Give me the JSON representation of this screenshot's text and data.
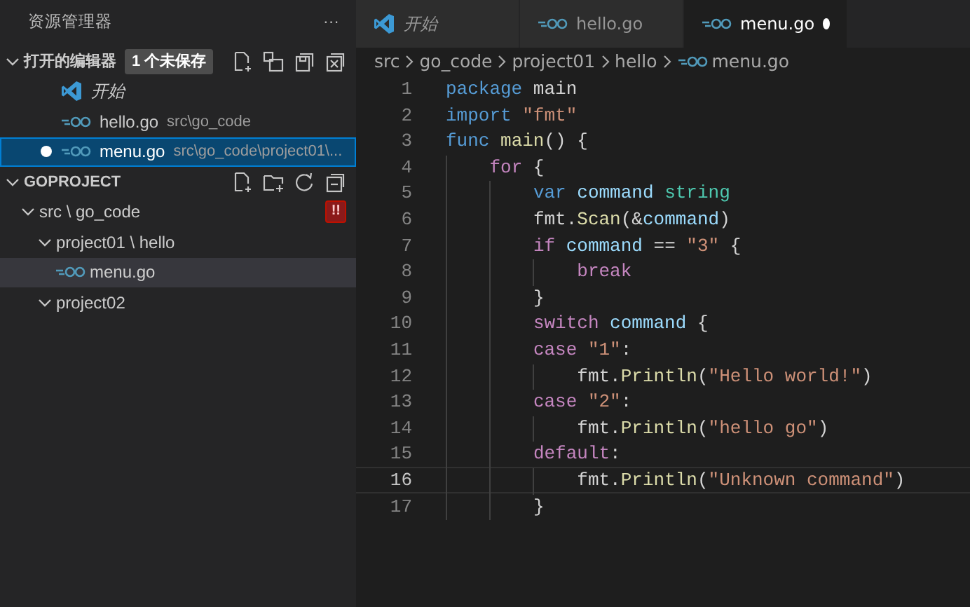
{
  "sidebar": {
    "title": "资源管理器",
    "more": "···",
    "open_editors": {
      "title": "打开的编辑器",
      "expanded": true,
      "badge": "1 个未保存",
      "items": [
        {
          "kind": "welcome",
          "label": "开始",
          "dirty": false,
          "selected": false
        },
        {
          "kind": "go",
          "label": "hello.go",
          "path": "src\\go_code",
          "dirty": false,
          "selected": false
        },
        {
          "kind": "go",
          "label": "menu.go",
          "path": "src\\go_code\\project01\\...",
          "dirty": true,
          "selected": true
        }
      ]
    },
    "project": {
      "title": "GOPROJECT",
      "expanded": true,
      "tree": [
        {
          "kind": "folder",
          "label": "src \\ go_code",
          "expanded": true,
          "badge": "!!",
          "children": [
            {
              "kind": "folder",
              "label": "project01 \\ hello",
              "expanded": true,
              "children": [
                {
                  "kind": "go",
                  "label": "menu.go",
                  "selected": true
                }
              ]
            },
            {
              "kind": "folder",
              "label": "project02",
              "expanded": true
            }
          ]
        }
      ]
    }
  },
  "tabs": [
    {
      "kind": "welcome",
      "label": "开始",
      "selected": false,
      "dirty": false
    },
    {
      "kind": "go",
      "label": "hello.go",
      "selected": false,
      "dirty": false
    },
    {
      "kind": "go",
      "label": "menu.go",
      "selected": true,
      "dirty": true
    }
  ],
  "breadcrumb": [
    {
      "label": "src"
    },
    {
      "label": "go_code"
    },
    {
      "label": "project01"
    },
    {
      "label": "hello"
    },
    {
      "label": "menu.go",
      "kind": "go"
    }
  ],
  "code": [
    {
      "number": "1",
      "current": false,
      "tokens": [
        {
          "kind": "kw",
          "text": "package"
        },
        {
          "kind": "plain",
          "text": " main"
        }
      ]
    },
    {
      "number": "2",
      "current": false,
      "tokens": [
        {
          "kind": "kw",
          "text": "import"
        },
        {
          "kind": "str",
          "text": " \"fmt\""
        }
      ]
    },
    {
      "number": "3",
      "current": false,
      "tokens": [
        {
          "kind": "kw",
          "text": "func"
        },
        {
          "kind": "fn",
          "text": " main"
        },
        {
          "kind": "plain",
          "text": "() {"
        }
      ]
    },
    {
      "number": "4",
      "current": false,
      "tokens": [
        {
          "kind": "ctl",
          "text": "    for"
        },
        {
          "kind": "plain",
          "text": " {"
        }
      ]
    },
    {
      "number": "5",
      "current": false,
      "tokens": [
        {
          "kind": "kw",
          "text": "        var"
        },
        {
          "kind": "var",
          "text": " command"
        },
        {
          "kind": "type",
          "text": " string"
        }
      ]
    },
    {
      "number": "6",
      "current": false,
      "tokens": [
        {
          "kind": "plain",
          "text": "        fmt."
        },
        {
          "kind": "fn",
          "text": "Scan"
        },
        {
          "kind": "plain",
          "text": "(&"
        },
        {
          "kind": "var",
          "text": "command"
        },
        {
          "kind": "plain",
          "text": ")"
        }
      ]
    },
    {
      "number": "7",
      "current": false,
      "tokens": [
        {
          "kind": "ctl",
          "text": "        if"
        },
        {
          "kind": "var",
          "text": " command"
        },
        {
          "kind": "plain",
          "text": " =="
        },
        {
          "kind": "str",
          "text": " \"3\""
        },
        {
          "kind": "plain",
          "text": " {"
        }
      ]
    },
    {
      "number": "8",
      "current": false,
      "tokens": [
        {
          "kind": "ctl",
          "text": "            break"
        }
      ]
    },
    {
      "number": "9",
      "current": false,
      "tokens": [
        {
          "kind": "plain",
          "text": "        }"
        }
      ]
    },
    {
      "number": "10",
      "current": false,
      "tokens": [
        {
          "kind": "ctl",
          "text": "        switch"
        },
        {
          "kind": "var",
          "text": " command"
        },
        {
          "kind": "plain",
          "text": " {"
        }
      ]
    },
    {
      "number": "11",
      "current": false,
      "tokens": [
        {
          "kind": "ctl",
          "text": "        case"
        },
        {
          "kind": "str",
          "text": " \"1\""
        },
        {
          "kind": "plain",
          "text": ":"
        }
      ]
    },
    {
      "number": "12",
      "current": false,
      "tokens": [
        {
          "kind": "plain",
          "text": "            fmt."
        },
        {
          "kind": "fn",
          "text": "Println"
        },
        {
          "kind": "plain",
          "text": "("
        },
        {
          "kind": "str",
          "text": "\"Hello world!\""
        },
        {
          "kind": "plain",
          "text": ")"
        }
      ]
    },
    {
      "number": "13",
      "current": false,
      "tokens": [
        {
          "kind": "ctl",
          "text": "        case"
        },
        {
          "kind": "str",
          "text": " \"2\""
        },
        {
          "kind": "plain",
          "text": ":"
        }
      ]
    },
    {
      "number": "14",
      "current": false,
      "tokens": [
        {
          "kind": "plain",
          "text": "            fmt."
        },
        {
          "kind": "fn",
          "text": "Println"
        },
        {
          "kind": "plain",
          "text": "("
        },
        {
          "kind": "str",
          "text": "\"hello go\""
        },
        {
          "kind": "plain",
          "text": ")"
        }
      ]
    },
    {
      "number": "15",
      "current": false,
      "tokens": [
        {
          "kind": "ctl",
          "text": "        default"
        },
        {
          "kind": "plain",
          "text": ":"
        }
      ]
    },
    {
      "number": "16",
      "current": true,
      "tokens": [
        {
          "kind": "plain",
          "text": "            fmt."
        },
        {
          "kind": "fn",
          "text": "Println"
        },
        {
          "kind": "plain",
          "text": "("
        },
        {
          "kind": "str",
          "text": "\"Unknown command\""
        },
        {
          "kind": "plain",
          "text": ")"
        }
      ]
    },
    {
      "number": "17",
      "current": false,
      "tokens": [
        {
          "kind": "plain",
          "text": "        }"
        }
      ]
    }
  ]
}
